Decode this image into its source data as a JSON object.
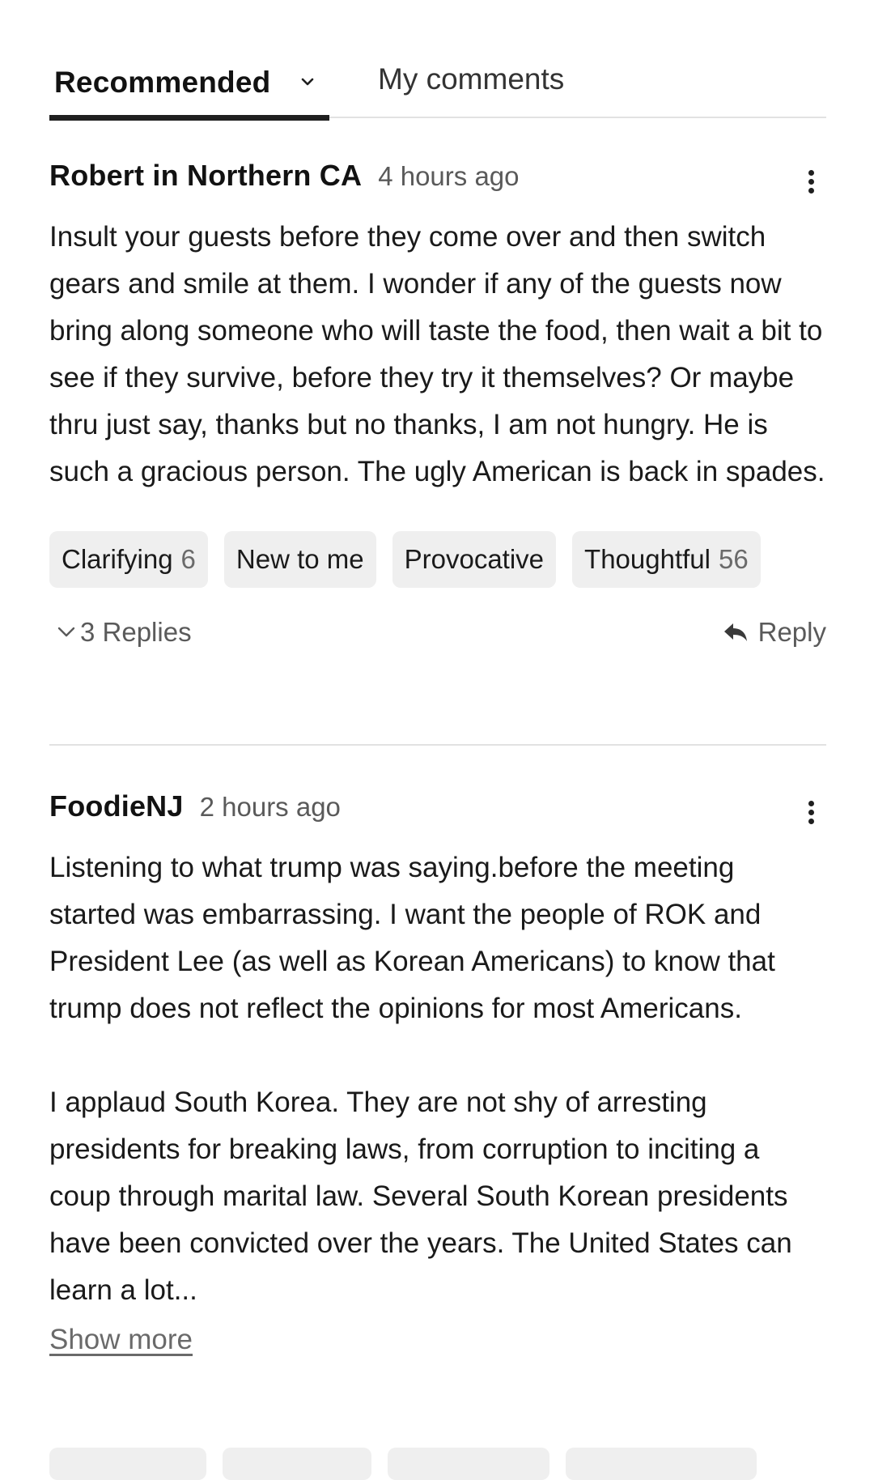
{
  "tabs": {
    "recommended": "Recommended",
    "my_comments": "My comments"
  },
  "comments": [
    {
      "author": "Robert in Northern CA",
      "time": "4 hours ago",
      "paragraphs": [
        "Insult your guests before they come over and then switch gears and smile at them. I wonder if any of the guests now bring along someone who will taste the food, then wait a bit to see if they survive, before they try it themselves? Or maybe thru just say, thanks but no thanks, I am not hungry. He is such a gracious person. The ugly American is back in spades."
      ],
      "reactions": [
        {
          "label": "Clarifying",
          "count": "6"
        },
        {
          "label": "New to me",
          "count": ""
        },
        {
          "label": "Provocative",
          "count": ""
        },
        {
          "label": "Thoughtful",
          "count": "56"
        }
      ],
      "replies_label": "3 Replies",
      "reply_label": "Reply"
    },
    {
      "author": "FoodieNJ",
      "time": "2 hours ago",
      "paragraphs": [
        "Listening to what trump was saying.before the meeting started was embarrassing. I want the people of ROK and President Lee (as well as Korean Americans) to know that trump does not reflect the opinions for most Americans.",
        "I applaud South Korea. They are not shy of arresting presidents for breaking laws, from corruption to inciting a coup through marital law. Several South Korean presidents have been convicted over the years. The United States can learn a lot..."
      ],
      "show_more": "Show more"
    }
  ],
  "icons": {
    "tab_dropdown": "chevron-down-icon",
    "more_options": "more-vertical-icon",
    "replies_toggle": "chevron-down-icon",
    "reply": "reply-arrow-icon"
  }
}
